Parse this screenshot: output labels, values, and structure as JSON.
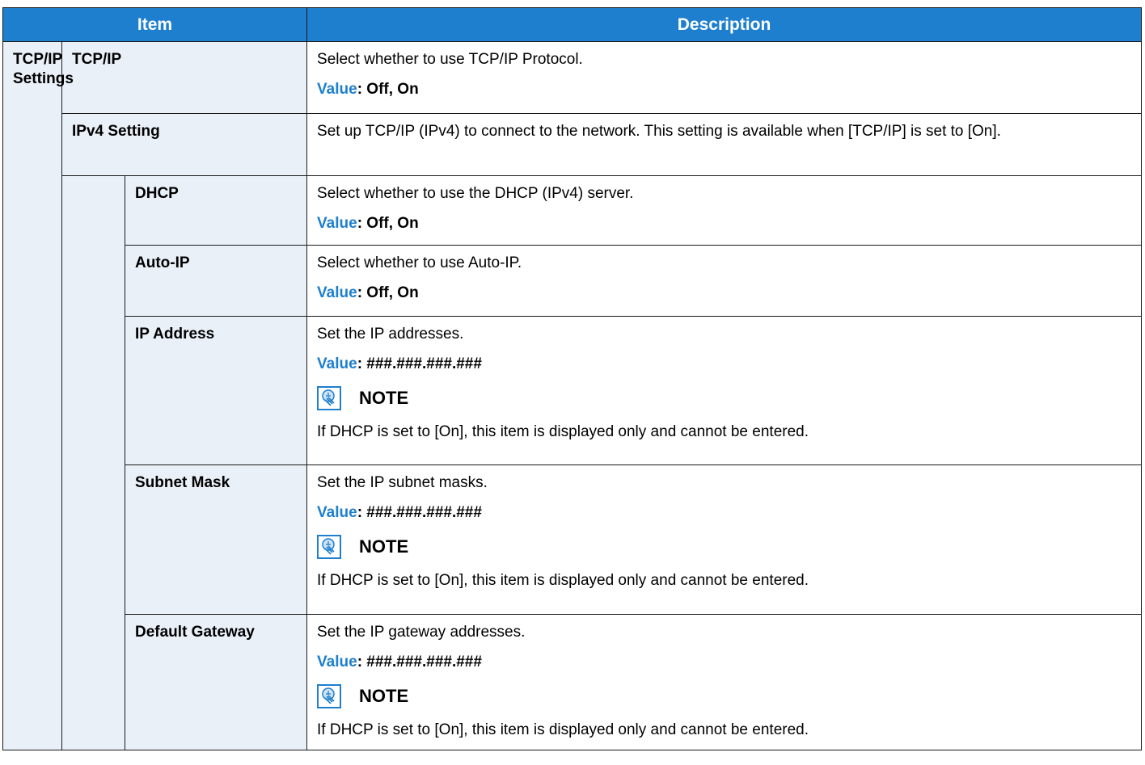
{
  "header": {
    "item": "Item",
    "description": "Description"
  },
  "group": {
    "label_line1": "TCP/IP",
    "label_line2": "Settings"
  },
  "note_label": "NOTE",
  "value_label": "Value",
  "rows": {
    "tcpip": {
      "label": "TCP/IP",
      "desc": "Select whether to use TCP/IP Protocol.",
      "value": ": Off, On"
    },
    "ipv4": {
      "label": "IPv4 Setting",
      "desc": "Set up TCP/IP (IPv4) to connect to the network. This setting is available when [TCP/IP] is set to [On]."
    },
    "dhcp": {
      "label": "DHCP",
      "desc": "Select whether to use the DHCP (IPv4) server.",
      "value": ": Off, On"
    },
    "autoip": {
      "label": "Auto-IP",
      "desc": "Select whether to use Auto-IP.",
      "value": ": Off, On"
    },
    "ipaddress": {
      "label": "IP Address",
      "desc": "Set the IP addresses.",
      "value": ": ###.###.###.###",
      "note": "If DHCP is set to [On], this item is displayed only and cannot be entered."
    },
    "subnet": {
      "label": "Subnet Mask",
      "desc": "Set the IP subnet masks.",
      "value": ": ###.###.###.###",
      "note": "If DHCP is set to [On], this item is displayed only and cannot be entered."
    },
    "gateway": {
      "label": "Default Gateway",
      "desc": "Set the IP gateway addresses.",
      "value": ": ###.###.###.###",
      "note": "If DHCP is set to [On], this item is displayed only and cannot be entered."
    }
  },
  "colors": {
    "header_bg": "#1e7fcf",
    "value_label": "#1e7fcf",
    "label_bg": "#eaf0f8"
  }
}
